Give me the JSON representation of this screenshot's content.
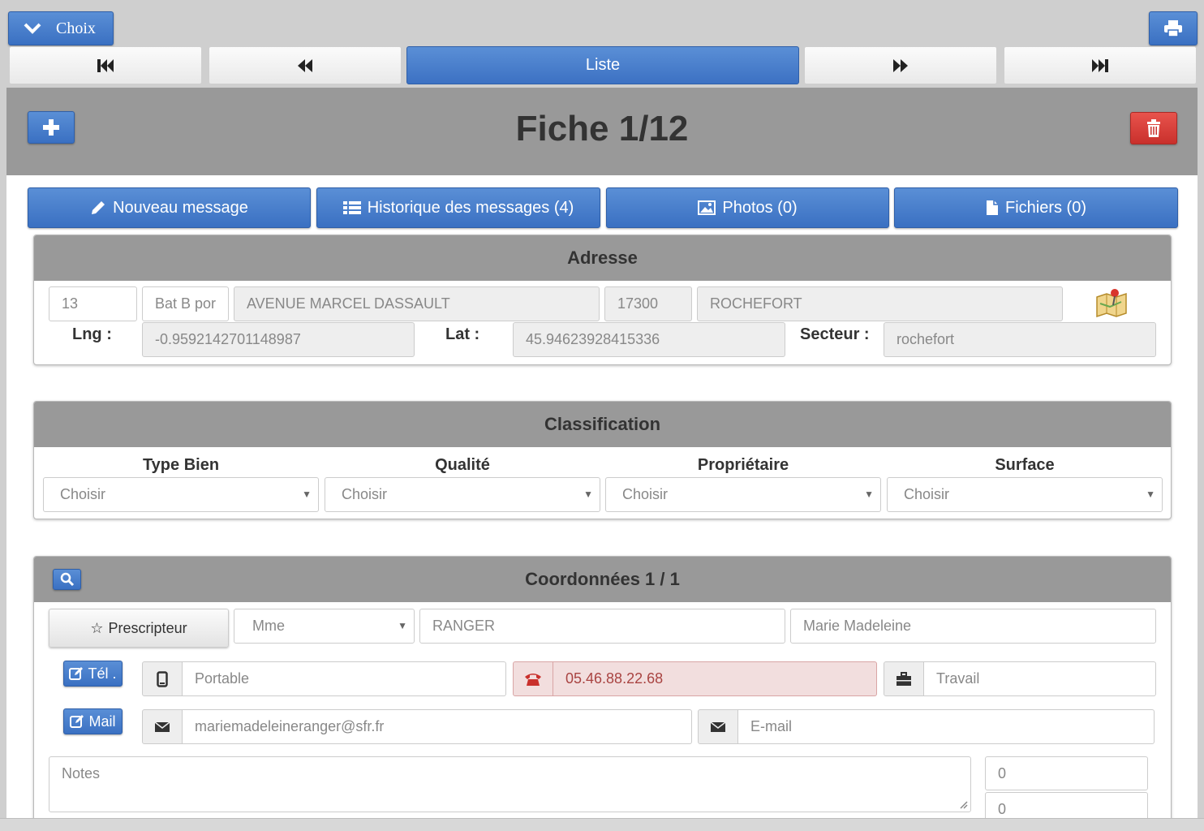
{
  "topbar": {
    "choix_label": "Choix",
    "print_icon": "print-icon"
  },
  "nav": {
    "first_icon": "skip-first-icon",
    "prev_icon": "fast-backward-icon",
    "liste_label": "Liste",
    "next_icon": "fast-forward-icon",
    "last_icon": "skip-last-icon"
  },
  "header": {
    "title": "Fiche 1/12"
  },
  "actions": {
    "nouveau": "Nouveau message",
    "historique": "Historique des messages (4)",
    "photos": "Photos (0)",
    "fichiers": "Fichiers (0)"
  },
  "adresse": {
    "title": "Adresse",
    "numero": "13",
    "complement": "Bat B por",
    "voie": "AVENUE MARCEL DASSAULT",
    "cp": "17300",
    "ville": "ROCHEFORT",
    "lng_label": "Lng :",
    "lng": "-0.9592142701148987",
    "lat_label": "Lat :",
    "lat": "45.94623928415336",
    "secteur_label": "Secteur :",
    "secteur": "rochefort"
  },
  "classification": {
    "title": "Classification",
    "columns": [
      {
        "label": "Type Bien",
        "value": "Choisir"
      },
      {
        "label": "Qualité",
        "value": "Choisir"
      },
      {
        "label": "Propriétaire",
        "value": "Choisir"
      },
      {
        "label": "Surface",
        "value": "Choisir"
      }
    ]
  },
  "coordonnees": {
    "title": "Coordonnées 1 / 1",
    "prescripteur": "Prescripteur",
    "civilite": "Mme",
    "nom": "RANGER",
    "prenom": "Marie Madeleine",
    "tel_label": "Tél .",
    "portable_placeholder": "Portable",
    "fixe": "05.46.88.22.68",
    "travail_placeholder": "Travail",
    "mail_label": "Mail",
    "email1": "mariemadeleineranger@sfr.fr",
    "email2_placeholder": "E-mail",
    "notes_placeholder": "Notes",
    "count1": "0",
    "count2": "0"
  },
  "colors": {
    "primary": "#3a70c2",
    "danger": "#c9302c",
    "panel_header": "#999999",
    "phone_highlight": "#f2dede"
  }
}
